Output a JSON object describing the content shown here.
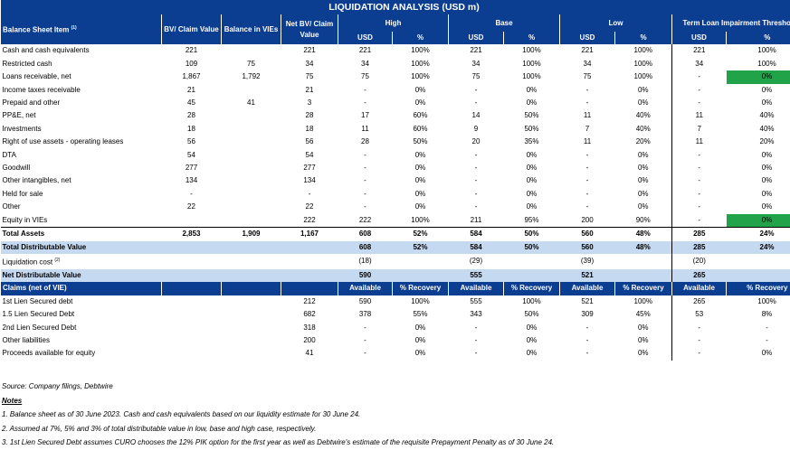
{
  "title": "LIQUIDATION ANALYSIS (USD m)",
  "headers": {
    "item": "Balance Sheet Item",
    "item_sup": "(1)",
    "bv": "BV/ Claim Value",
    "vie": "Balance in VIEs",
    "net": "Net BV/ Claim Value",
    "high": "High",
    "base": "Base",
    "low": "Low",
    "term": "Term Loan Impairment Threshold",
    "usd": "USD",
    "pct": "%"
  },
  "rows": [
    {
      "label": "Cash and cash equivalents",
      "bv": "221",
      "vie": "",
      "net": "221",
      "h_usd": "221",
      "h_pct": "100%",
      "b_usd": "221",
      "b_pct": "100%",
      "l_usd": "221",
      "l_pct": "100%",
      "t_usd": "221",
      "t_pct": "100%"
    },
    {
      "label": "Restricted cash",
      "bv": "109",
      "vie": "75",
      "net": "34",
      "h_usd": "34",
      "h_pct": "100%",
      "b_usd": "34",
      "b_pct": "100%",
      "l_usd": "34",
      "l_pct": "100%",
      "t_usd": "34",
      "t_pct": "100%"
    },
    {
      "label": "Loans receivable, net",
      "bv": "1,867",
      "vie": "1,792",
      "net": "75",
      "h_usd": "75",
      "h_pct": "100%",
      "b_usd": "75",
      "b_pct": "100%",
      "l_usd": "75",
      "l_pct": "100%",
      "t_usd": "-",
      "t_pct": "0%",
      "hl": true
    },
    {
      "label": "Income taxes receivable",
      "bv": "21",
      "vie": "",
      "net": "21",
      "h_usd": "-",
      "h_pct": "0%",
      "b_usd": "-",
      "b_pct": "0%",
      "l_usd": "-",
      "l_pct": "0%",
      "t_usd": "-",
      "t_pct": "0%"
    },
    {
      "label": "Prepaid and other",
      "bv": "45",
      "vie": "41",
      "net": "3",
      "h_usd": "-",
      "h_pct": "0%",
      "b_usd": "-",
      "b_pct": "0%",
      "l_usd": "-",
      "l_pct": "0%",
      "t_usd": "-",
      "t_pct": "0%"
    },
    {
      "label": "PP&E, net",
      "bv": "28",
      "vie": "",
      "net": "28",
      "h_usd": "17",
      "h_pct": "60%",
      "b_usd": "14",
      "b_pct": "50%",
      "l_usd": "11",
      "l_pct": "40%",
      "t_usd": "11",
      "t_pct": "40%"
    },
    {
      "label": "Investments",
      "bv": "18",
      "vie": "",
      "net": "18",
      "h_usd": "11",
      "h_pct": "60%",
      "b_usd": "9",
      "b_pct": "50%",
      "l_usd": "7",
      "l_pct": "40%",
      "t_usd": "7",
      "t_pct": "40%"
    },
    {
      "label": "Right of use assets - operating leases",
      "bv": "56",
      "vie": "",
      "net": "56",
      "h_usd": "28",
      "h_pct": "50%",
      "b_usd": "20",
      "b_pct": "35%",
      "l_usd": "11",
      "l_pct": "20%",
      "t_usd": "11",
      "t_pct": "20%"
    },
    {
      "label": "DTA",
      "bv": "54",
      "vie": "",
      "net": "54",
      "h_usd": "-",
      "h_pct": "0%",
      "b_usd": "-",
      "b_pct": "0%",
      "l_usd": "-",
      "l_pct": "0%",
      "t_usd": "-",
      "t_pct": "0%"
    },
    {
      "label": "Goodwill",
      "bv": "277",
      "vie": "",
      "net": "277",
      "h_usd": "-",
      "h_pct": "0%",
      "b_usd": "-",
      "b_pct": "0%",
      "l_usd": "-",
      "l_pct": "0%",
      "t_usd": "-",
      "t_pct": "0%"
    },
    {
      "label": "Other intangibles, net",
      "bv": "134",
      "vie": "",
      "net": "134",
      "h_usd": "-",
      "h_pct": "0%",
      "b_usd": "-",
      "b_pct": "0%",
      "l_usd": "-",
      "l_pct": "0%",
      "t_usd": "-",
      "t_pct": "0%"
    },
    {
      "label": "Held for sale",
      "bv": "-",
      "vie": "",
      "net": "-",
      "h_usd": "-",
      "h_pct": "0%",
      "b_usd": "-",
      "b_pct": "0%",
      "l_usd": "-",
      "l_pct": "0%",
      "t_usd": "-",
      "t_pct": "0%"
    },
    {
      "label": "Other",
      "bv": "22",
      "vie": "",
      "net": "22",
      "h_usd": "-",
      "h_pct": "0%",
      "b_usd": "-",
      "b_pct": "0%",
      "l_usd": "-",
      "l_pct": "0%",
      "t_usd": "-",
      "t_pct": "0%"
    },
    {
      "label": "Equity in VIEs",
      "bv": "",
      "vie": "",
      "net": "222",
      "h_usd": "222",
      "h_pct": "100%",
      "b_usd": "211",
      "b_pct": "95%",
      "l_usd": "200",
      "l_pct": "90%",
      "t_usd": "-",
      "t_pct": "0%",
      "hl": true
    }
  ],
  "total_assets": {
    "label": "Total Assets",
    "bv": "2,853",
    "vie": "1,909",
    "net": "1,167",
    "h_usd": "608",
    "h_pct": "52%",
    "b_usd": "584",
    "b_pct": "50%",
    "l_usd": "560",
    "l_pct": "48%",
    "t_usd": "285",
    "t_pct": "24%"
  },
  "total_dist": {
    "label": "Total Distributable Value",
    "h_usd": "608",
    "h_pct": "52%",
    "b_usd": "584",
    "b_pct": "50%",
    "l_usd": "560",
    "l_pct": "48%",
    "t_usd": "285",
    "t_pct": "24%"
  },
  "liq_cost": {
    "label": "Liquidation cost",
    "sup": "(2)",
    "h_usd": "(18)",
    "b_usd": "(29)",
    "l_usd": "(39)",
    "t_usd": "(20)"
  },
  "net_dist": {
    "label": "Net Distributable Value",
    "h_usd": "590",
    "b_usd": "555",
    "l_usd": "521",
    "t_usd": "265"
  },
  "claims_header": {
    "label": "Claims (net of VIE)",
    "avail": "Available",
    "rec": "% Recovery"
  },
  "claims": [
    {
      "label": "1st Lien Secured debt",
      "net": "212",
      "h_usd": "590",
      "h_pct": "100%",
      "b_usd": "555",
      "b_pct": "100%",
      "l_usd": "521",
      "l_pct": "100%",
      "t_usd": "265",
      "t_pct": "100%"
    },
    {
      "label": "1.5 Lien Secured Debt",
      "net": "682",
      "h_usd": "378",
      "h_pct": "55%",
      "b_usd": "343",
      "b_pct": "50%",
      "l_usd": "309",
      "l_pct": "45%",
      "t_usd": "53",
      "t_pct": "8%"
    },
    {
      "label": "2nd Lien Secured Debt",
      "net": "318",
      "h_usd": "-",
      "h_pct": "0%",
      "b_usd": "-",
      "b_pct": "0%",
      "l_usd": "-",
      "l_pct": "0%",
      "t_usd": "-",
      "t_pct": "-"
    },
    {
      "label": "Other liabilities",
      "net": "200",
      "h_usd": "-",
      "h_pct": "0%",
      "b_usd": "-",
      "b_pct": "0%",
      "l_usd": "-",
      "l_pct": "0%",
      "t_usd": "-",
      "t_pct": "-"
    },
    {
      "label": "Proceeds available for equity",
      "net": "41",
      "h_usd": "-",
      "h_pct": "0%",
      "b_usd": "-",
      "b_pct": "0%",
      "l_usd": "-",
      "l_pct": "0%",
      "t_usd": "-",
      "t_pct": "0%"
    }
  ],
  "source": "Source: Company filings, Debtwire",
  "notes_title": "Notes",
  "notes": [
    "1. Balance sheet as of 30 June 2023. Cash and cash equivalents based on our liquidity estimate for 30 June 24.",
    "2. Assumed at 7%, 5% and 3% of total distributable value in low, base and high case, respectively.",
    "3. 1st Lien Secured Debt assumes CURO chooses the 12% PIK option for the first year as well as Debtwire's estimate of the requisite Prepayment Penalty as of 30 June 24."
  ],
  "colors": {
    "header_blue": "#0b3d91",
    "light_blue": "#c5d9f1",
    "highlight_green": "#21a34a"
  }
}
